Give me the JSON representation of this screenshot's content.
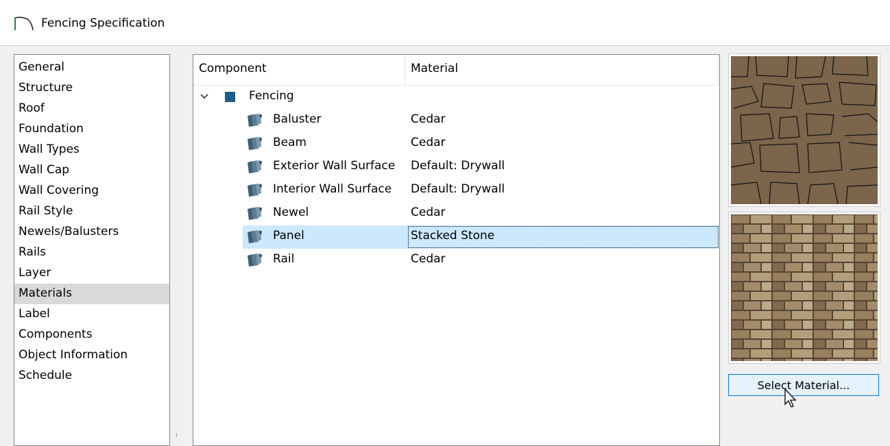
{
  "window": {
    "title": "Fencing Specification",
    "icon": "arch-icon"
  },
  "sidebar": {
    "items": [
      {
        "label": "General"
      },
      {
        "label": "Structure"
      },
      {
        "label": "Roof"
      },
      {
        "label": "Foundation"
      },
      {
        "label": "Wall Types"
      },
      {
        "label": "Wall Cap"
      },
      {
        "label": "Wall Covering"
      },
      {
        "label": "Rail Style"
      },
      {
        "label": "Newels/Balusters"
      },
      {
        "label": "Rails"
      },
      {
        "label": "Layer"
      },
      {
        "label": "Materials",
        "selected": true
      },
      {
        "label": "Label"
      },
      {
        "label": "Components"
      },
      {
        "label": "Object Information"
      },
      {
        "label": "Schedule"
      }
    ]
  },
  "materials_tree": {
    "columns": {
      "component": "Component",
      "material": "Material"
    },
    "group": {
      "label": "Fencing",
      "expanded": true,
      "color": "#1a5f87"
    },
    "rows": [
      {
        "component": "Baluster",
        "material": "Cedar"
      },
      {
        "component": "Beam",
        "material": "Cedar"
      },
      {
        "component": "Exterior Wall Surface",
        "material": "Default: Drywall"
      },
      {
        "component": "Interior Wall Surface",
        "material": "Default: Drywall"
      },
      {
        "component": "Newel",
        "material": "Cedar"
      },
      {
        "component": "Panel",
        "material": "Stacked Stone",
        "selected": true
      },
      {
        "component": "Rail",
        "material": "Cedar"
      }
    ]
  },
  "preview": {
    "pattern_color": "#7b654b",
    "texture_color": "#8a7358"
  },
  "actions": {
    "select_material": "Select Material..."
  },
  "colors": {
    "selection": "#cce8ff",
    "accent": "#0078d7",
    "sidebar_selection": "#d9d9d9"
  }
}
